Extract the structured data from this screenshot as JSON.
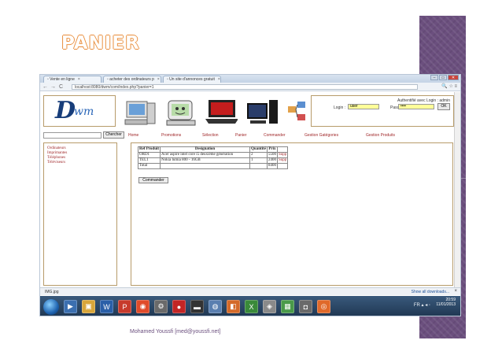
{
  "slide": {
    "title": "PANIER",
    "footer": "Mohamed Youssfi [med@youssfi.net]"
  },
  "browser": {
    "tabs": [
      {
        "label": "Vente en ligne",
        "icon": "page-icon"
      },
      {
        "label": "acheter des ordinateurs p",
        "icon": "page-icon"
      },
      {
        "label": "Un site d'annonces gratuit",
        "icon": "page-icon"
      }
    ],
    "url": "localhost:8080/dwm/com/index.php?panier=1",
    "window_buttons": {
      "minimize": "–",
      "maximize": "▭",
      "close": "✕"
    }
  },
  "page": {
    "logo_letter": "D",
    "logo_rest": "wm",
    "auth": {
      "title": "Authentifié avec Login : admin",
      "login_label": "Login :",
      "login_value": "user",
      "pass_label": "Pass",
      "pass_value": "••••",
      "ok_label": "OK"
    },
    "search_button": "Chercher",
    "menu": [
      "Home",
      "Promotions",
      "Sélection",
      "Panier",
      "Commander",
      "Gestion Gatégories",
      "Gestion Produits"
    ],
    "sidebar": [
      "Ordinateurs",
      "Imprimantes",
      "Téléphones",
      "Téléviseurs"
    ],
    "cart": {
      "headers": [
        "Ref Produit",
        "Designation",
        "Quantité",
        "Prix",
        ""
      ],
      "rows": [
        {
          "ref": "ORD1",
          "designation": "Acer aspire intel core i5 deuxième génération",
          "qty": "2",
          "price": "5500",
          "action": "Supp"
        },
        {
          "ref": "TEL1",
          "designation": "Nokia lumia 800 - 16GB",
          "qty": "1",
          "price": "2400",
          "action": "Supp"
        }
      ],
      "total_label": "Total",
      "total_value": "8400"
    },
    "order_button": "Commander"
  },
  "downloads": {
    "file": "IMG.jpg",
    "show_all": "Show all downloads..."
  },
  "taskbar": {
    "lang": "FR",
    "time": "20:59",
    "date": "11/01/2013"
  },
  "colors": {
    "menu_link": "#a0282a",
    "accent_purple": "#6b4f7e",
    "title_orange": "#e88c3a"
  }
}
